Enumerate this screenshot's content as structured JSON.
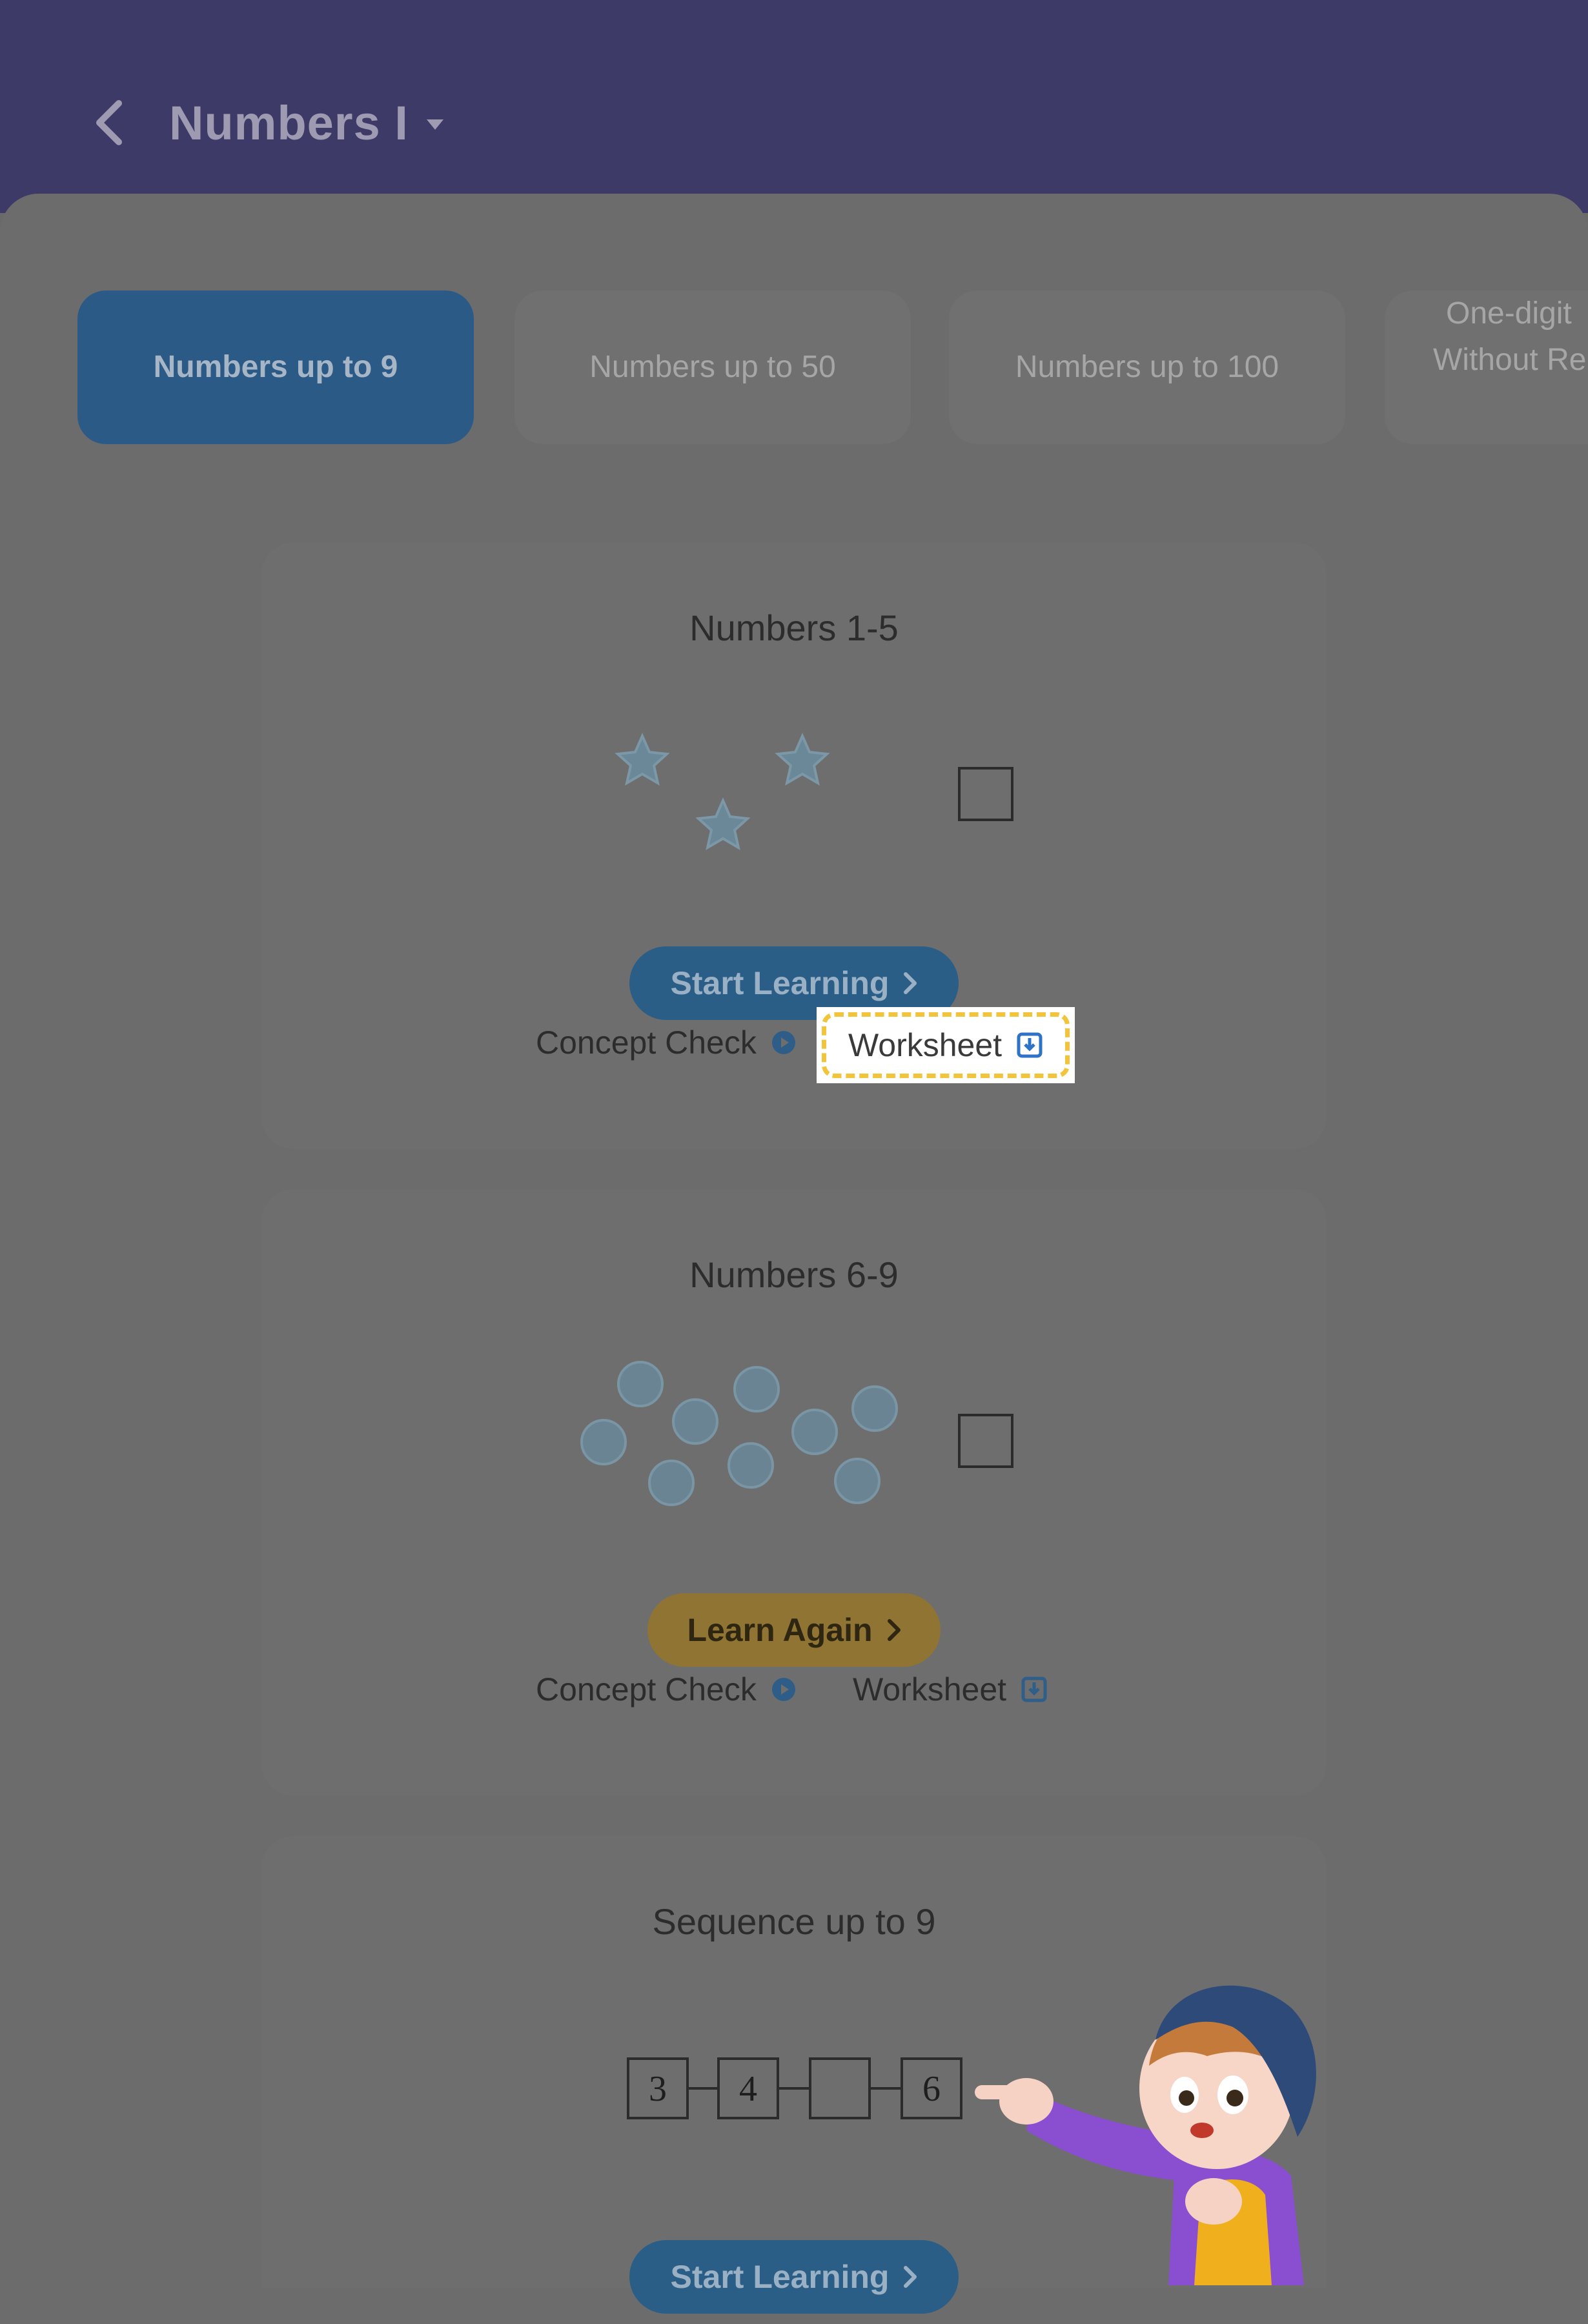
{
  "header": {
    "title": "Numbers I",
    "back_icon": "chevron-left-icon",
    "dropdown_icon": "caret-down-icon"
  },
  "tabs": [
    {
      "label": "Numbers up to 9",
      "active": true
    },
    {
      "label": "Numbers up to 50",
      "active": false
    },
    {
      "label": "Numbers up to 100",
      "active": false
    },
    {
      "label_line1": "One-digit",
      "label_line2": "Without Re",
      "active": false
    }
  ],
  "cards": [
    {
      "title": "Numbers 1-5",
      "button_label": "Start Learning",
      "button_style": "blue",
      "concept_check": "Concept Check",
      "worksheet": "Worksheet",
      "worksheet_highlighted": true
    },
    {
      "title": "Numbers 6-9",
      "button_label": "Learn Again",
      "button_style": "gold",
      "concept_check": "Concept Check",
      "worksheet": "Worksheet",
      "worksheet_highlighted": false
    },
    {
      "title": "Sequence up to 9",
      "sequence": [
        "3",
        "4",
        "",
        "6"
      ],
      "button_label": "Start Learning",
      "button_style": "blue"
    }
  ],
  "colors": {
    "header_bg": "#3e3a67",
    "overlay_bg": "#6a6a6a",
    "active_tab": "#2c5a86",
    "start_button": "#2a5e87",
    "learn_again_button": "#8f7434",
    "highlight_border": "#f2c43b"
  }
}
